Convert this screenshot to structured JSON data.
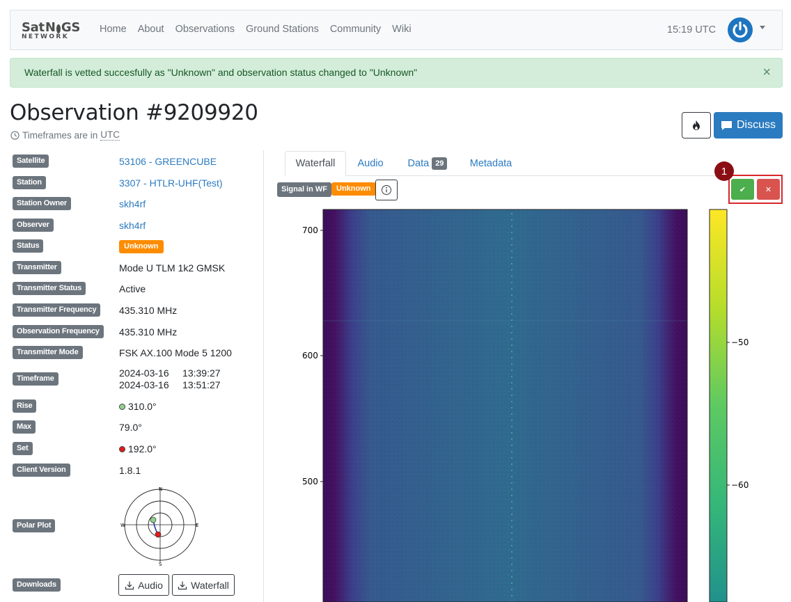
{
  "brand": {
    "top": "SatNOGS",
    "bottom": "NETWORK"
  },
  "nav": {
    "links": [
      "Home",
      "About",
      "Observations",
      "Ground Stations",
      "Community",
      "Wiki"
    ],
    "time": "15:19 UTC"
  },
  "alert": {
    "message": "Waterfall is vetted succesfully as \"Unknown\" and observation status changed to \"Unknown\"",
    "close": "×"
  },
  "page": {
    "title": "Observation #9209920",
    "tz_prefix": "Timeframes are in",
    "tz_value": "UTC",
    "discuss_label": "Discuss"
  },
  "info": {
    "satellite": {
      "label": "Satellite",
      "value": "53106 - GREENCUBE"
    },
    "station": {
      "label": "Station",
      "value": "3307 - HTLR-UHF(Test)"
    },
    "station_owner": {
      "label": "Station Owner",
      "value": "skh4rf"
    },
    "observer": {
      "label": "Observer",
      "value": "skh4rf"
    },
    "status": {
      "label": "Status",
      "value": "Unknown"
    },
    "transmitter": {
      "label": "Transmitter",
      "value": "Mode U TLM 1k2 GMSK"
    },
    "transmitter_status": {
      "label": "Transmitter Status",
      "value": "Active"
    },
    "transmitter_frequency": {
      "label": "Transmitter Frequency",
      "value": "435.310 MHz"
    },
    "observation_frequency": {
      "label": "Observation Frequency",
      "value": "435.310 MHz"
    },
    "transmitter_mode": {
      "label": "Transmitter Mode",
      "value": "FSK AX.100 Mode 5 1200"
    },
    "timeframe": {
      "label": "Timeframe",
      "start": "2024-03-16     13:39:27",
      "end": "2024-03-16     13:51:27"
    },
    "rise": {
      "label": "Rise",
      "value": "310.0°",
      "color": "#8fd18f"
    },
    "max": {
      "label": "Max",
      "value": "79.0°"
    },
    "set": {
      "label": "Set",
      "value": "192.0°",
      "color": "#e01b1b"
    },
    "client_version": {
      "label": "Client Version",
      "value": "1.8.1"
    },
    "polar_plot": {
      "label": "Polar Plot",
      "n": "N",
      "e": "E",
      "s": "S",
      "w": "W"
    },
    "downloads": {
      "label": "Downloads",
      "audio": "Audio",
      "waterfall": "Waterfall"
    }
  },
  "tabs": [
    {
      "label": "Waterfall"
    },
    {
      "label": "Audio"
    },
    {
      "label": "Data",
      "count": "29"
    },
    {
      "label": "Metadata"
    }
  ],
  "vetting": {
    "signal_badge": "Signal in WF",
    "status_badge": "Unknown",
    "step_marker": "1",
    "ok_symbol": "✔",
    "bad_symbol": "✕"
  },
  "waterfall": {
    "y_ticks": [
      "700",
      "600",
      "500"
    ],
    "colorbar_ticks": [
      "−50",
      "−60"
    ]
  },
  "colors": {
    "accent": "#2b7bc0",
    "status_unknown": "#fd8c00",
    "vet_good": "#4cae4c",
    "vet_bad": "#d9534f",
    "alert_bg": "#d4edda"
  }
}
